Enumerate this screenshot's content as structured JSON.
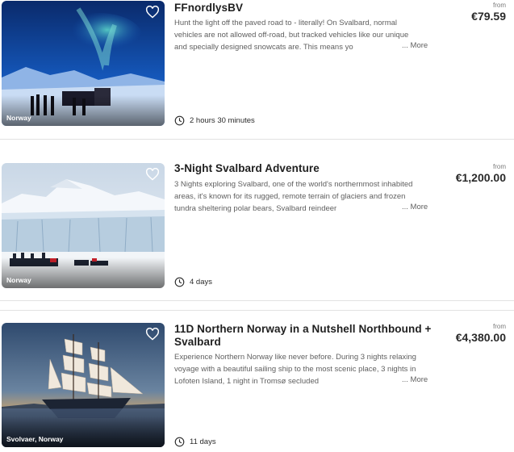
{
  "listings": [
    {
      "title": "FFnordlysBV",
      "description": "Hunt the light off the paved road to - literally! On Svalbard, normal vehicles are not allowed off-road, but tracked vehicles like our unique and specially designed snowcats are. This means yo",
      "more_label": "... More",
      "duration": "2 hours 30 minutes",
      "location": "Norway",
      "from_label": "from",
      "price": "€79.59",
      "image_icon": "aurora-snowcat-photo"
    },
    {
      "title": "3-Night Svalbard Adventure",
      "description": "3 Nights exploring Svalbard, one of the world's northernmost inhabited areas, it's known for its rugged, remote terrain of glaciers and frozen tundra sheltering polar bears, Svalbard reindeer",
      "more_label": "... More",
      "duration": "4 days",
      "location": "Norway",
      "from_label": "from",
      "price": "€1,200.00",
      "image_icon": "glacier-snowmobiles-photo"
    },
    {
      "title": "11D Northern Norway in a Nutshell Northbound + Svalbard",
      "description": "Experience Northern Norway like never before. During 3 nights relaxing voyage with a beautiful sailing ship to the most scenic place, 3 nights in Lofoten Island, 1 night in Tromsø secluded",
      "more_label": "... More",
      "duration": "11 days",
      "location": "Svolvaer, Norway",
      "from_label": "from",
      "price": "€4,380.00",
      "image_icon": "tall-ship-sunset-photo"
    }
  ],
  "icons": {
    "favorite": "heart-outline-icon",
    "duration": "clock-icon"
  },
  "colors": {
    "title": "#1f1f1f",
    "description": "#5f5f5f",
    "divider": "#e2e2e2"
  }
}
